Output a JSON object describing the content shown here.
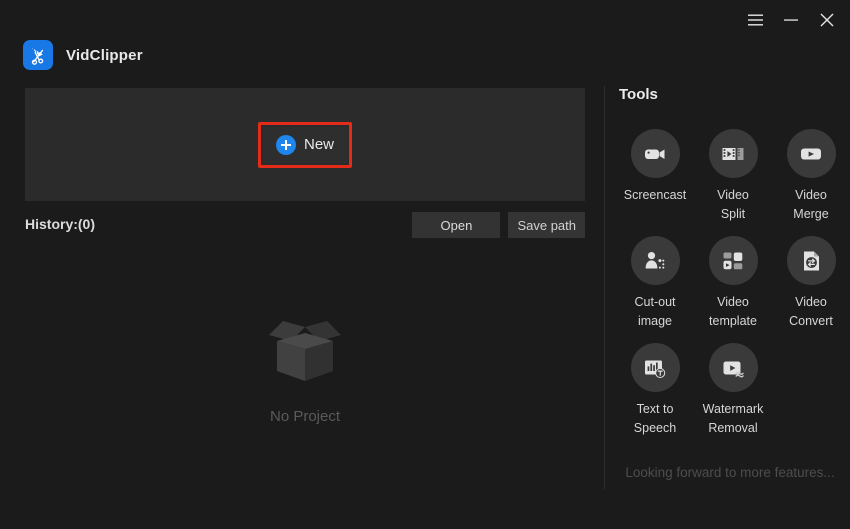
{
  "window": {
    "title": "VidClipper",
    "controls": [
      {
        "name": "menu-button",
        "icon": "hamburger-icon"
      },
      {
        "name": "minimize-button",
        "icon": "minimize-icon"
      },
      {
        "name": "close-button",
        "icon": "close-icon"
      }
    ]
  },
  "brand": {
    "name": "VidClipper",
    "logo_icon": "vidclipper-logo-icon",
    "logo_color": "#1878e6"
  },
  "main": {
    "new_button": {
      "label": "New",
      "icon": "plus-circle-icon",
      "accent_color": "#1e86ec",
      "highlight_color": "#e42a19",
      "highlighted": true
    },
    "history": {
      "label": "History:(0)",
      "count": 0,
      "open_label": "Open",
      "save_path_label": "Save path"
    },
    "empty_state": {
      "label": "No Project",
      "icon": "empty-box-icon"
    }
  },
  "tools": {
    "title": "Tools",
    "footer": "Looking forward to more features...",
    "items": [
      {
        "label": "Screencast",
        "icon": "camcorder-icon",
        "name": "screencast"
      },
      {
        "label": "Video\nSplit",
        "icon": "film-split-icon",
        "name": "video-split"
      },
      {
        "label": "Video\nMerge",
        "icon": "video-play-icon",
        "name": "video-merge"
      },
      {
        "label": "Cut-out\nimage",
        "icon": "person-cutout-icon",
        "name": "cut-out-image"
      },
      {
        "label": "Video\ntemplate",
        "icon": "template-grid-icon",
        "name": "video-template"
      },
      {
        "label": "Video\nConvert",
        "icon": "file-convert-icon",
        "name": "video-convert"
      },
      {
        "label": "Text to\nSpeech",
        "icon": "waveform-text-icon",
        "name": "text-to-speech"
      },
      {
        "label": "Watermark\nRemoval",
        "icon": "watermark-remove-icon",
        "name": "watermark-removal"
      }
    ]
  }
}
